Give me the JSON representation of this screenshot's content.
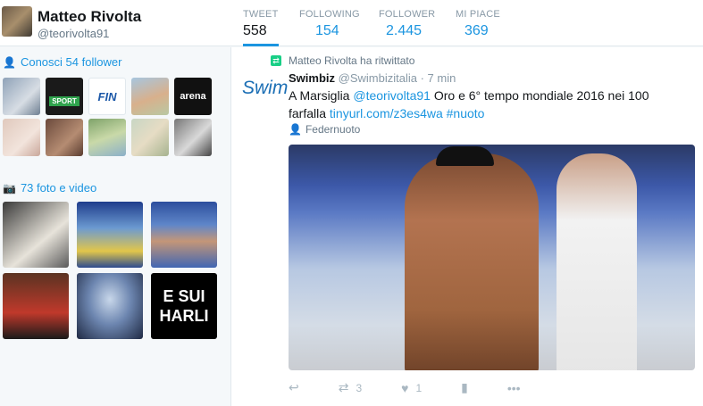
{
  "profile": {
    "name": "Matteo Rivolta",
    "handle": "@teorivolta91"
  },
  "stats": [
    {
      "label": "TWEET",
      "value": "558"
    },
    {
      "label": "FOLLOWING",
      "value": "154"
    },
    {
      "label": "FOLLOWER",
      "value": "2.445"
    },
    {
      "label": "MI PIACE",
      "value": "369"
    }
  ],
  "sidebar": {
    "followers_title": "Conosci 54 follower",
    "media_title": "73 foto e video",
    "follower_thumbs": [
      {
        "label": ""
      },
      {
        "label": "SPORT"
      },
      {
        "label": "FIN"
      },
      {
        "label": ""
      },
      {
        "label": "arena"
      },
      {
        "label": ""
      },
      {
        "label": ""
      },
      {
        "label": ""
      },
      {
        "label": ""
      },
      {
        "label": ""
      }
    ],
    "media_thumbs": [
      {
        "label": ""
      },
      {
        "label": ""
      },
      {
        "label": ""
      },
      {
        "label": ""
      },
      {
        "label": ""
      },
      {
        "label": "E SUI\nHARLI"
      }
    ]
  },
  "tweet": {
    "retweet_note": "Matteo Rivolta ha ritwittato",
    "author_name": "Swimbiz",
    "author_handle": "@Swimbizitalia",
    "time": "· 7 min",
    "text_pre": "A Marsiglia ",
    "mention": "@teorivolta91",
    "text_mid": " Oro e 6° tempo mondiale 2016 nei 100 farfalla ",
    "link": "tinyurl.com/z3es4wa",
    "hashtag": "#nuoto",
    "location": "Federnuoto",
    "retweet_count": "3",
    "like_count": "1",
    "avatar_text": "Swim"
  },
  "colors": {
    "accent": "#1b95e0",
    "retweet": "#19cf86"
  }
}
